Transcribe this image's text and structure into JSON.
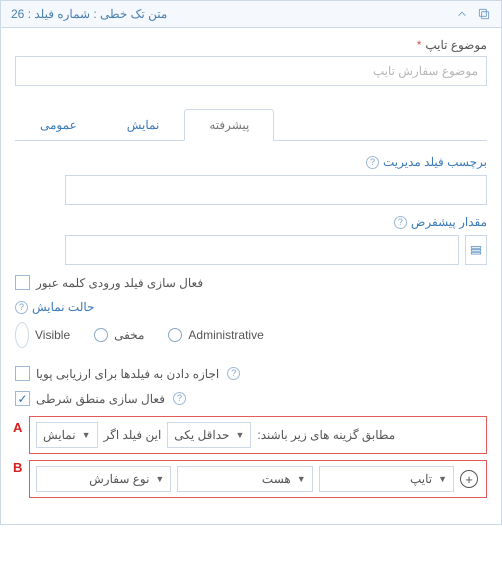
{
  "header": {
    "title": "متن تک خطی : شماره فیلد : 26"
  },
  "topic": {
    "label": "موضوع تایپ",
    "required": "*",
    "placeholder": "موضوع سفارش تایپ"
  },
  "tabs": {
    "advanced": "پیشرفته",
    "display": "نمایش",
    "general": "عمومی"
  },
  "adv": {
    "admin_label": "برچسب فیلد مدیریت",
    "default_value": "مقدار پیشفرض",
    "enable_password": "فعال سازی فیلد ورودی کلمه عبور",
    "display_mode_title": "حالت نمایش",
    "radios": {
      "visible": "Visible",
      "hidden": "مخفی",
      "administrative": "Administrative"
    },
    "allow_dynamic": "اجازه دادن به فیلدها برای ارزیابی پویا",
    "enable_conditional": "فعال سازی منطق شرطی"
  },
  "cond": {
    "letter_a": "A",
    "letter_b": "B",
    "rowA": {
      "action": "نمایش",
      "if_text": "این فیلد اگر",
      "match": "حداقل یکی",
      "tail": "مطابق گزینه های زیر باشند:"
    },
    "rowB": {
      "field": "نوع سفارش",
      "op": "هست",
      "value": "تایپ"
    }
  }
}
